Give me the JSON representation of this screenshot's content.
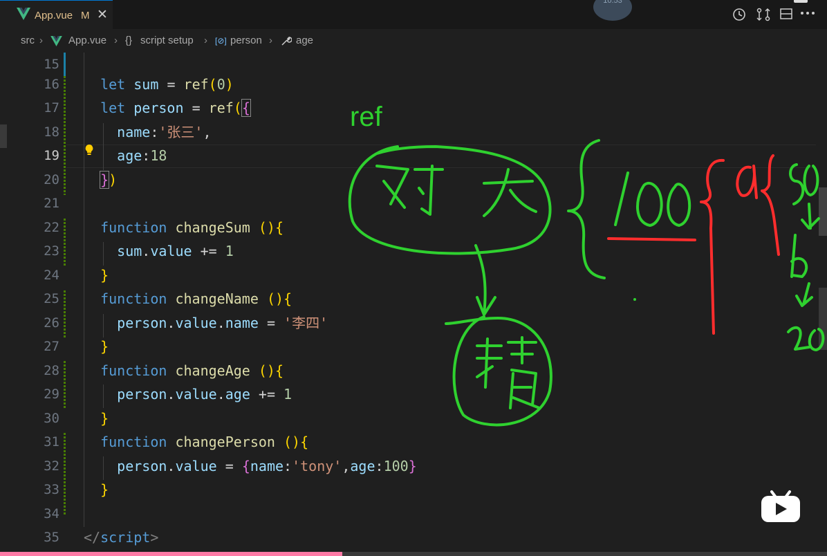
{
  "tab": {
    "filename": "App.vue",
    "status": "M",
    "close": "✕"
  },
  "time_badge": "10:53",
  "breadcrumb": {
    "folder": "src",
    "file": "App.vue",
    "section_icon": "{}",
    "section": "script setup",
    "var_icon": "[⊘]",
    "var": "person",
    "prop": "age"
  },
  "editor": {
    "line_numbers": [
      "15",
      "16",
      "17",
      "18",
      "19",
      "20",
      "21",
      "22",
      "23",
      "24",
      "25",
      "26",
      "27",
      "28",
      "29",
      "30",
      "31",
      "32",
      "33",
      "34",
      "35"
    ],
    "active_line": "19"
  },
  "annotations": {
    "label_ref": "ref",
    "color_green": "#2fd12f",
    "color_red": "#ff2d2d"
  },
  "colors": {
    "accent": "#0078d4",
    "background": "#1f1f1f"
  }
}
